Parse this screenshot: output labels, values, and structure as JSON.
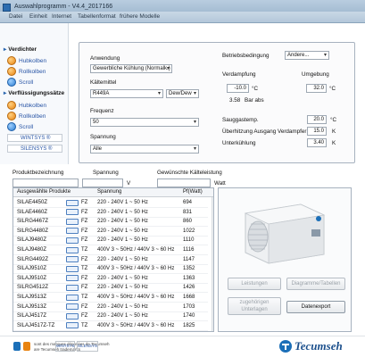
{
  "window": {
    "title": "Auswahlprogramm - V4.4_2017166"
  },
  "menu": [
    "Datei",
    "Einheit",
    "Internet",
    "Tabellenformat",
    "frühere Modelle"
  ],
  "sidebar": {
    "sections": [
      {
        "label": "Verdichter",
        "items": [
          {
            "label": "Hubkolben",
            "icon": "piston-icon"
          },
          {
            "label": "Rollkolben",
            "icon": "rotary-icon"
          },
          {
            "label": "Scroll",
            "icon": "scroll-icon"
          }
        ]
      },
      {
        "label": "Verflüssigungssätze",
        "items": [
          {
            "label": "Hubkolben",
            "icon": "piston-icon"
          },
          {
            "label": "Rollkolben",
            "icon": "rotary-icon"
          },
          {
            "label": "Scroll",
            "icon": "scroll-icon"
          }
        ],
        "boxes": [
          "WINTSYS ®",
          "SILENSYS ®"
        ]
      }
    ]
  },
  "settings": {
    "anwendung": {
      "label": "Anwendung",
      "value": "Gewerbliche Kühlung (Normalk.)"
    },
    "kaeltemittel": {
      "label": "Kältemittel",
      "value": "R449A",
      "mode": "Dew/Dew"
    },
    "frequenz": {
      "label": "Frequenz",
      "value": "50"
    },
    "spannung": {
      "label": "Spannung",
      "value": "Alle"
    },
    "betriebsbedingung": {
      "label": "Betriebsbedingung",
      "value": "Andere..."
    },
    "verdampfung": {
      "label": "Verdampfung",
      "value": "-10.0",
      "unit": "°C",
      "pressure": "3.58",
      "pressure_unit": "Bar abs"
    },
    "umgebung": {
      "label": "Umgebung",
      "value": "32.0",
      "unit": "°C"
    },
    "sauggastemp": {
      "label": "Sauggastemp.",
      "value": "20.0",
      "unit": "°C"
    },
    "ueberhitzung": {
      "label": "Überhitzung Ausgang Verdampfer",
      "value": "15.0",
      "unit": "K"
    },
    "unterkuehlung": {
      "label": "Unterkühlung",
      "value": "3.40",
      "unit": "K"
    }
  },
  "filter": {
    "produkt_label": "Produktbezeichnung",
    "spannung_label": "Spannung",
    "spannung_unit": "V",
    "kaelte_label": "Gewünschte Kälteleistung",
    "kaelte_unit": "Watt"
  },
  "table": {
    "headers": [
      "Ausgewählte Produkte",
      "Spannung",
      "Pf(Watt)"
    ],
    "rows": [
      [
        "SILAE4450Z",
        "FZ",
        "220 - 240V 1 ~ 50 Hz",
        "694"
      ],
      [
        "SILAE4460Z",
        "FZ",
        "220 - 240V 1 ~ 50 Hz",
        "831"
      ],
      [
        "SILRG4467Z",
        "FZ",
        "220 - 240V 1 ~ 50 Hz",
        "860"
      ],
      [
        "SILRG4480Z",
        "FZ",
        "220 - 240V 1 ~ 50 Hz",
        "1022"
      ],
      [
        "SILAJ9480Z",
        "FZ",
        "220 - 240V 1 ~ 50 Hz",
        "1110"
      ],
      [
        "SILAJ9480Z",
        "TZ",
        "400V 3 ~ 50Hz / 440V 3 ~ 60 Hz",
        "1116"
      ],
      [
        "SILRG4492Z",
        "FZ",
        "220 - 240V 1 ~ 50 Hz",
        "1147"
      ],
      [
        "SILAJ9510Z",
        "TZ",
        "400V 3 ~ 50Hz / 440V 3 ~ 60 Hz",
        "1352"
      ],
      [
        "SILAJ9510Z",
        "FZ",
        "220 - 240V 1 ~ 50 Hz",
        "1363"
      ],
      [
        "SILRG4512Z",
        "FZ",
        "220 - 240V 1 ~ 50 Hz",
        "1426"
      ],
      [
        "SILAJ9513Z",
        "TZ",
        "400V 3 ~ 50Hz / 440V 3 ~ 60 Hz",
        "1668"
      ],
      [
        "SILAJ9513Z",
        "FZ",
        "220 - 240V 1 ~ 50 Hz",
        "1703"
      ],
      [
        "SILAJ4517Z",
        "FZ",
        "220 - 240V 1 ~ 50 Hz",
        "1740"
      ],
      [
        "SILAJ4517Z-TZ",
        "TZ",
        "400V 3 ~ 50Hz / 440V 3 ~ 60 Hz",
        "1825"
      ]
    ]
  },
  "buttons": {
    "leistungen": "Leistungen",
    "diagramme": "Diagramme/Tabellen",
    "unterlagen_1": "zugehörigen",
    "unterlagen_2": "Unterlagen",
    "datenexport": "Datenexport"
  },
  "footer": {
    "text_1": "sont des marques déposées de Tecumseh",
    "text_2": "are Tecumseh trademarks",
    "logo_small_1": "WINTSYS",
    "logo_small_2": "SILENSYS",
    "brand": "Tecumseh"
  },
  "colors": {
    "accent": "#2754a5",
    "brand_blue": "#1b6fb8",
    "orange": "#e88412"
  }
}
